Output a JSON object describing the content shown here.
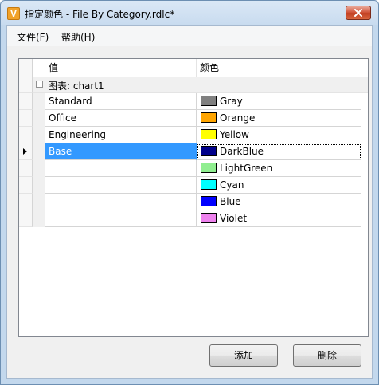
{
  "window": {
    "title": "指定颜色 - File By Category.rdlc*",
    "app_icon_letter": "V",
    "close_icon": "close-icon"
  },
  "menu": {
    "items": [
      "文件(F)",
      "帮助(H)"
    ]
  },
  "grid": {
    "columns": [
      "值",
      "颜色"
    ],
    "group": {
      "label": "图表: chart1",
      "expander_icon": "collapse-minus-icon"
    },
    "rows": [
      {
        "value": "Standard",
        "color_name": "Gray",
        "swatch": "#808080"
      },
      {
        "value": "Office",
        "color_name": "Orange",
        "swatch": "#ffa500"
      },
      {
        "value": "Engineering",
        "color_name": "Yellow",
        "swatch": "#ffff00"
      },
      {
        "value": "Base",
        "color_name": "DarkBlue",
        "swatch": "#00008b"
      },
      {
        "value": "",
        "color_name": "LightGreen",
        "swatch": "#90ee90"
      },
      {
        "value": "",
        "color_name": "Cyan",
        "swatch": "#00ffff"
      },
      {
        "value": "",
        "color_name": "Blue",
        "swatch": "#0000ff"
      },
      {
        "value": "",
        "color_name": "Violet",
        "swatch": "#ee82ee"
      }
    ],
    "selected_row_index": 3,
    "selection_color": "#3399ff"
  },
  "buttons": {
    "add": "添加",
    "delete": "删除"
  }
}
